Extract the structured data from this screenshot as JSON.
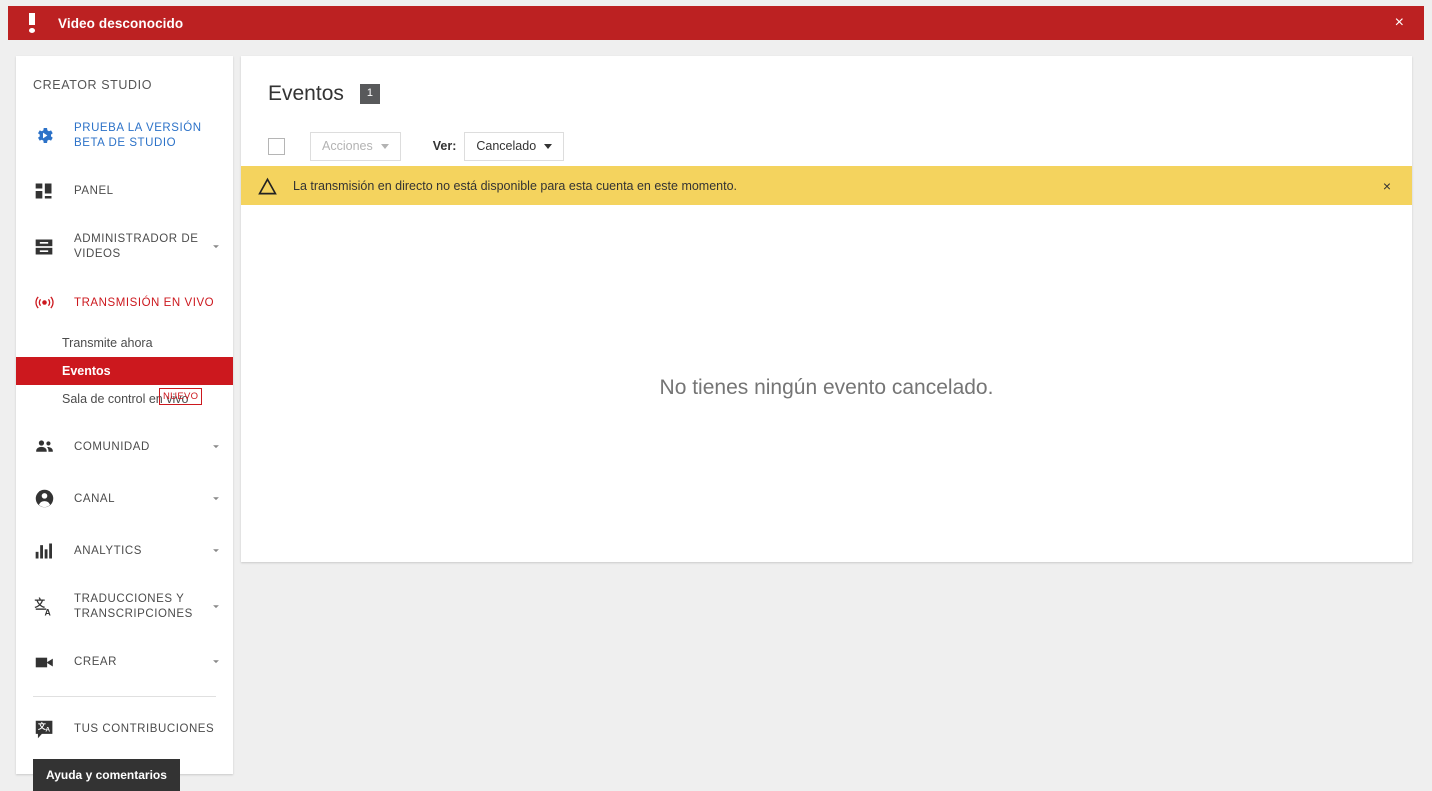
{
  "top_alert": {
    "icon": "exclamation-icon",
    "text": "Video desconocido",
    "close_label": "×",
    "bg_color": "#bc2122"
  },
  "sidebar": {
    "title": "CREATOR STUDIO",
    "items": [
      {
        "icon": "beta-gear-icon",
        "label": "PRUEBA LA VERSIÓN BETA DE STUDIO",
        "style": "blue",
        "chevron": false
      },
      {
        "icon": "dashboard-icon",
        "label": "PANEL",
        "style": "",
        "chevron": false
      },
      {
        "icon": "video-manager-icon",
        "label": "ADMINISTRADOR DE VIDEOS",
        "style": "",
        "chevron": true
      },
      {
        "icon": "live-broadcast-icon",
        "label": "TRANSMISIÓN EN VIVO",
        "style": "red",
        "chevron": false
      }
    ],
    "sub_items": [
      {
        "label": "Transmite ahora",
        "active": false,
        "badge": ""
      },
      {
        "label": "Eventos",
        "active": true,
        "badge": ""
      },
      {
        "label": "Sala de control en vivo",
        "active": false,
        "badge": "NUEVO"
      }
    ],
    "items2": [
      {
        "icon": "community-icon",
        "label": "COMUNIDAD",
        "style": "",
        "chevron": true
      },
      {
        "icon": "channel-icon",
        "label": "CANAL",
        "style": "",
        "chevron": true
      },
      {
        "icon": "analytics-icon",
        "label": "ANALYTICS",
        "style": "",
        "chevron": true
      },
      {
        "icon": "translate-icon",
        "label": "TRADUCCIONES Y TRANSCRIPCIONES",
        "style": "",
        "chevron": true
      },
      {
        "icon": "create-icon",
        "label": "CREAR",
        "style": "",
        "chevron": true
      }
    ],
    "contributions": {
      "icon": "contributions-icon",
      "label": "TUS CONTRIBUCIONES"
    },
    "help_button": "Ayuda y comentarios"
  },
  "main": {
    "page_title": "Eventos",
    "count_badge": "1",
    "toolbar": {
      "select_all_checkbox": "",
      "actions_label": "Acciones",
      "view_label": "Ver:",
      "view_value": "Cancelado"
    },
    "warning": {
      "icon": "warning-triangle-icon",
      "text": "La transmisión en directo no está disponible para esta cuenta en este momento.",
      "close_label": "×",
      "bg_color": "#f4d35e"
    },
    "empty_state": "No tienes ningún evento cancelado."
  }
}
